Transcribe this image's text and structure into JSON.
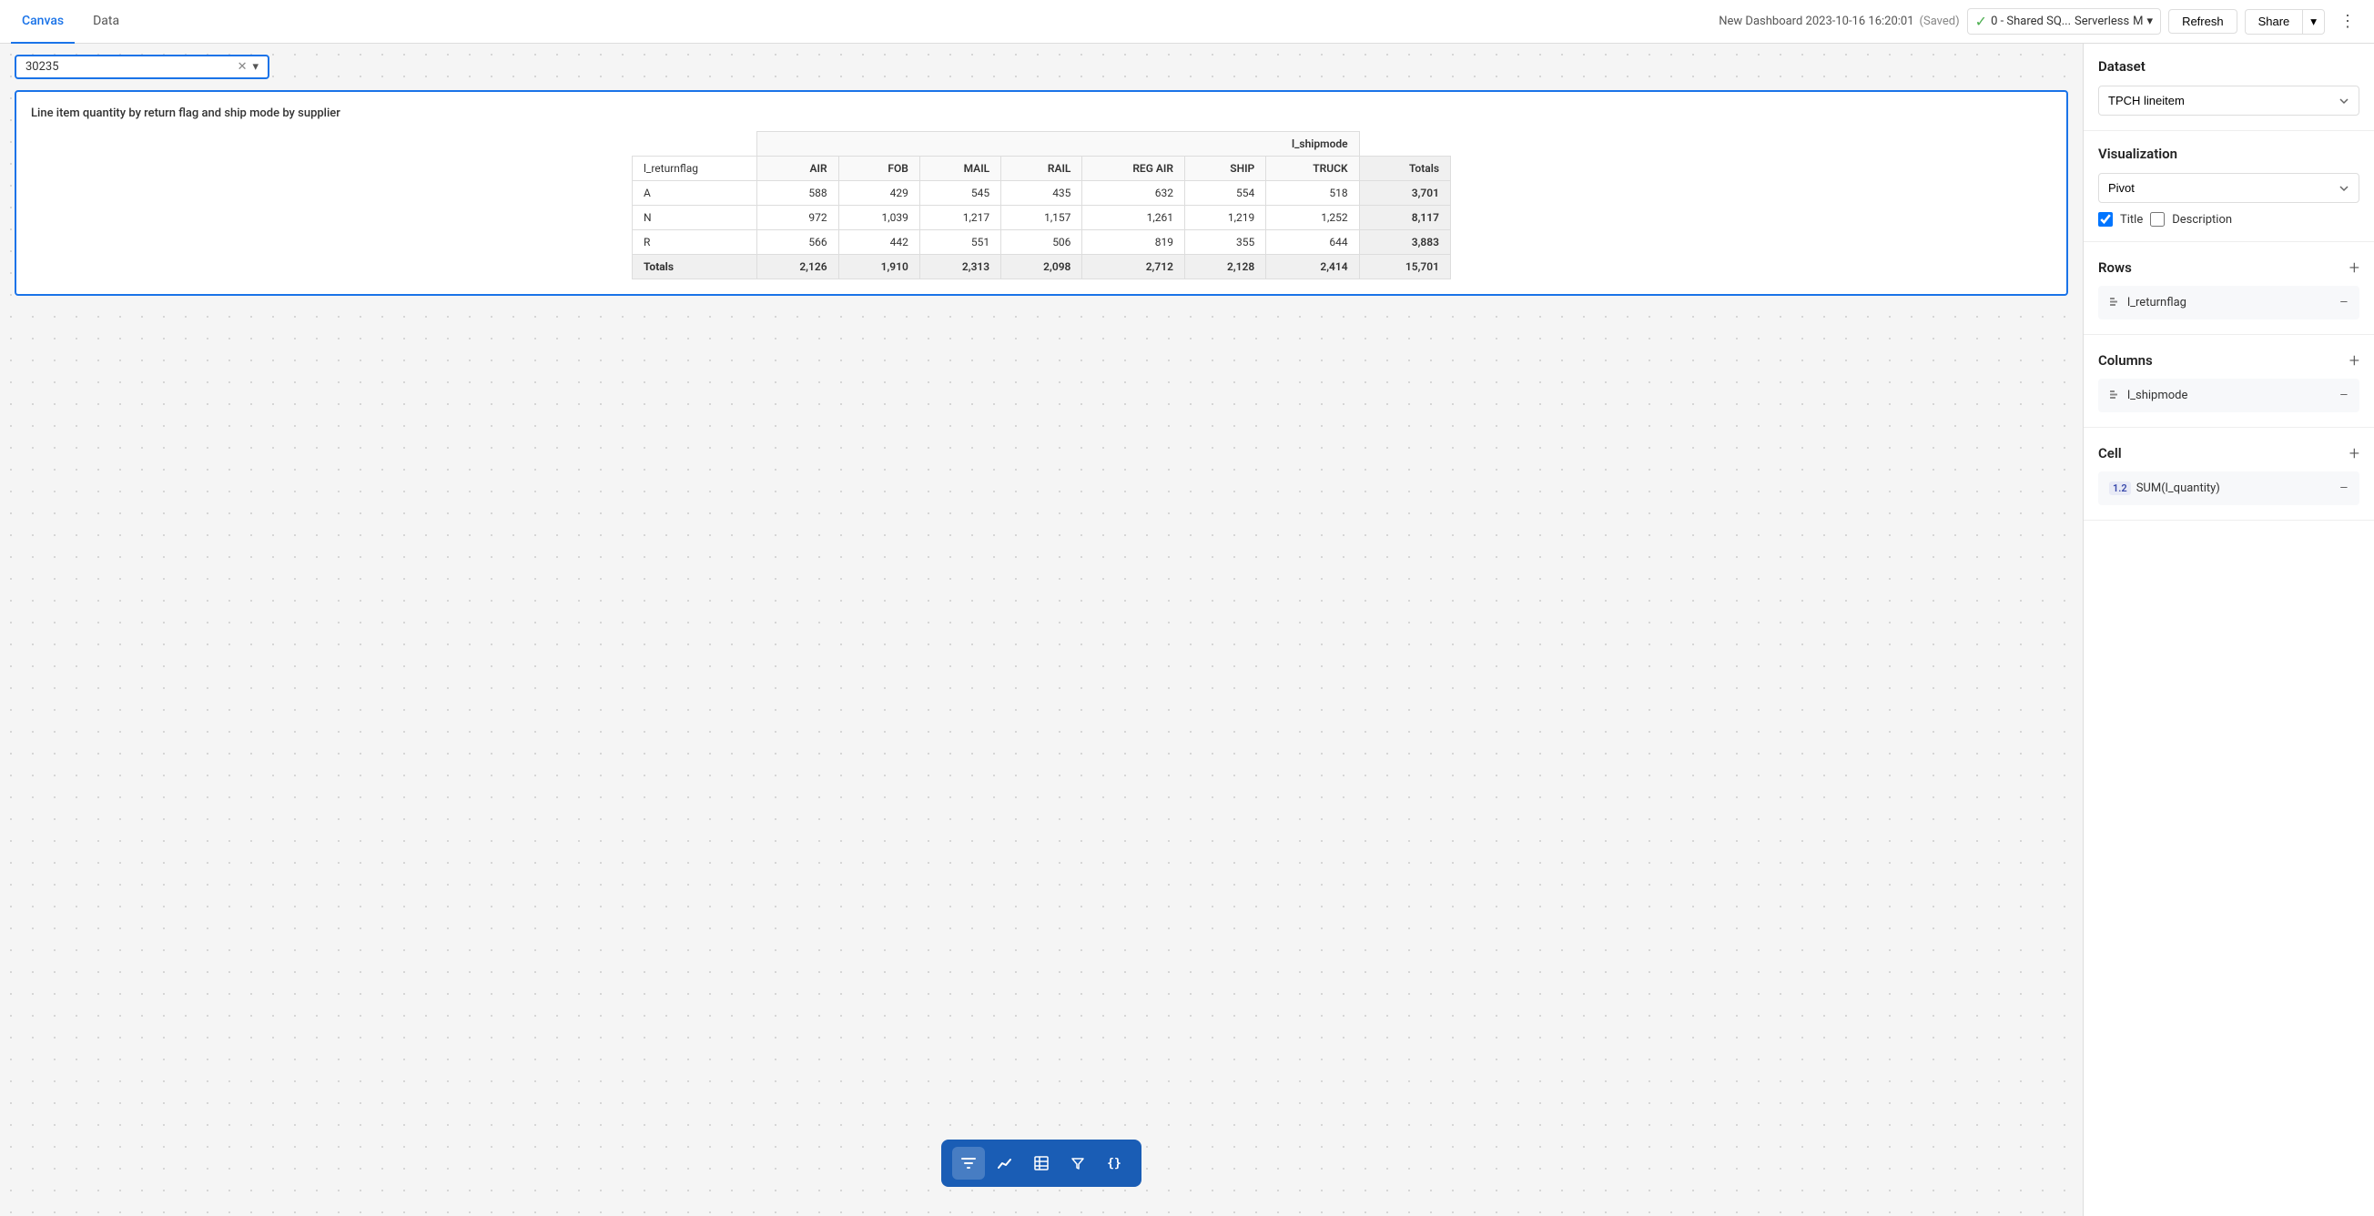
{
  "topnav": {
    "tabs": [
      {
        "id": "canvas",
        "label": "Canvas",
        "active": true
      },
      {
        "id": "data",
        "label": "Data",
        "active": false
      }
    ],
    "dashboard_title": "New Dashboard 2023-10-16 16:20:01",
    "saved_label": "(Saved)",
    "connection_icon": "✓",
    "connection_name": "0 - Shared SQ...",
    "connection_type": "Serverless",
    "connection_size": "M",
    "refresh_label": "Refresh",
    "share_label": "Share",
    "more_icon": "⋮"
  },
  "filter": {
    "value": "30235",
    "clear_icon": "✕",
    "caret_icon": "▾"
  },
  "chart": {
    "title": "Line item quantity by return flag and ship mode by supplier",
    "pivot": {
      "col_group": "l_shipmode",
      "columns": [
        "l_returnflag",
        "AIR",
        "FOB",
        "MAIL",
        "RAIL",
        "REG AIR",
        "SHIP",
        "TRUCK",
        "Totals"
      ],
      "rows": [
        {
          "flag": "A",
          "AIR": 588,
          "FOB": 429,
          "MAIL": 545,
          "RAIL": 435,
          "REG_AIR": 632,
          "SHIP": 554,
          "TRUCK": 518,
          "total": 3701
        },
        {
          "flag": "N",
          "AIR": 972,
          "FOB": 1039,
          "MAIL": 1217,
          "RAIL": 1157,
          "REG_AIR": 1261,
          "SHIP": 1219,
          "TRUCK": 1252,
          "total": 8117
        },
        {
          "flag": "R",
          "AIR": 566,
          "FOB": 442,
          "MAIL": 551,
          "RAIL": 506,
          "REG_AIR": 819,
          "SHIP": 355,
          "TRUCK": 644,
          "total": 3883
        }
      ],
      "totals": {
        "label": "Totals",
        "AIR": 2126,
        "FOB": 1910,
        "MAIL": 2313,
        "RAIL": 2098,
        "REG_AIR": 2712,
        "SHIP": 2128,
        "TRUCK": 2414,
        "total": 15701
      }
    }
  },
  "toolbar": {
    "buttons": [
      {
        "id": "filter",
        "icon": "⊘",
        "active": true
      },
      {
        "id": "chart",
        "icon": "📈",
        "active": false
      },
      {
        "id": "table",
        "icon": "⊞",
        "active": false
      },
      {
        "id": "filter2",
        "icon": "▽",
        "active": false
      },
      {
        "id": "code",
        "icon": "{}",
        "active": false
      }
    ]
  },
  "panel": {
    "dataset_label": "Dataset",
    "dataset_value": "TPCH lineitem",
    "visualization_label": "Visualization",
    "visualization_value": "Pivot",
    "title_label": "Title",
    "title_checked": true,
    "description_label": "Description",
    "description_checked": false,
    "rows_label": "Rows",
    "rows_item": "l_returnflag",
    "columns_label": "Columns",
    "columns_item": "l_shipmode",
    "cell_label": "Cell",
    "cell_item_badge": "1.2",
    "cell_item_label": "SUM(l_quantity)"
  }
}
